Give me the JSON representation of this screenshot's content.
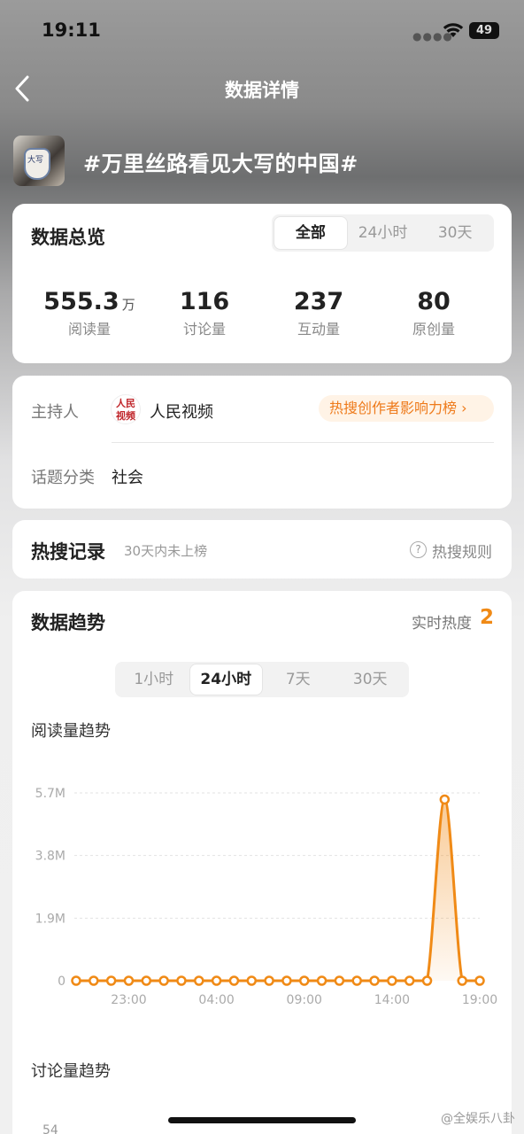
{
  "status": {
    "time": "19:11",
    "battery": "49"
  },
  "nav": {
    "title": "数据详情"
  },
  "topic": {
    "title": "#万里丝路看见大写的中国#",
    "thumb_text": "大写"
  },
  "overview": {
    "title": "数据总览",
    "tabs": [
      "全部",
      "24小时",
      "30天"
    ],
    "active_tab": "全部",
    "stats": [
      {
        "value": "555.3",
        "unit": "万",
        "label": "阅读量"
      },
      {
        "value": "116",
        "unit": "",
        "label": "讨论量"
      },
      {
        "value": "237",
        "unit": "",
        "label": "互动量"
      },
      {
        "value": "80",
        "unit": "",
        "label": "原创量"
      }
    ]
  },
  "info": {
    "host_label": "主持人",
    "host_name": "人民视频",
    "host_logo_text": "人民视频",
    "influence_link": "热搜创作者影响力榜 ›",
    "category_label": "话题分类",
    "category_value": "社会"
  },
  "hot_search": {
    "title": "热搜记录",
    "note": "30天内未上榜",
    "rules": "热搜规则"
  },
  "trend": {
    "title": "数据趋势",
    "heat_label": "实时热度",
    "heat_value": "2",
    "tabs": [
      "1小时",
      "24小时",
      "7天",
      "30天"
    ],
    "active_tab": "24小时",
    "read_title": "阅读量趋势",
    "discuss_title": "讨论量趋势",
    "discuss_y_top": "54"
  },
  "colors": {
    "accent": "#ee7a1a",
    "line": "#f08a16"
  },
  "chart_data": {
    "type": "area",
    "title": "阅读量趋势",
    "xlabel": "",
    "ylabel": "",
    "y_ticks": [
      "0",
      "1.9M",
      "3.8M",
      "5.7M"
    ],
    "ylim": [
      0,
      5700000
    ],
    "x_ticks": [
      "23:00",
      "04:00",
      "09:00",
      "14:00",
      "19:00"
    ],
    "grid": true,
    "series": [
      {
        "values": [
          0,
          0,
          0,
          0,
          0,
          0,
          0,
          0,
          0,
          0,
          0,
          0,
          0,
          0,
          0,
          0,
          0,
          0,
          0,
          0,
          0,
          5500000,
          0,
          0
        ]
      }
    ]
  },
  "watermark": "@全娱乐八卦"
}
